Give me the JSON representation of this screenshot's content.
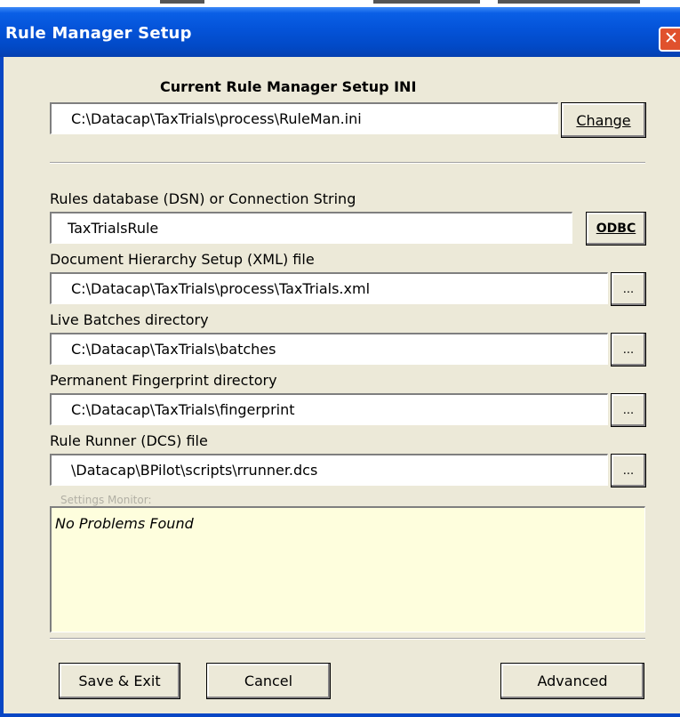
{
  "window": {
    "title": "Rule Manager Setup",
    "close_glyph": "✕"
  },
  "ini": {
    "heading": "Current Rule Manager Setup INI",
    "path": "C:\\Datacap\\TaxTrials\\process\\RuleMan.ini",
    "change_label": "Change"
  },
  "dsn": {
    "label": "Rules database (DSN) or Connection String",
    "value": "TaxTrialsRule",
    "odbc_label": "ODBC"
  },
  "hierarchy": {
    "label": "Document Hierarchy Setup (XML) file",
    "value": "C:\\Datacap\\TaxTrials\\process\\TaxTrials.xml"
  },
  "batches": {
    "label": "Live Batches directory",
    "value": "C:\\Datacap\\TaxTrials\\batches"
  },
  "fingerprint": {
    "label": "Permanent Fingerprint directory",
    "value": "C:\\Datacap\\TaxTrials\\fingerprint"
  },
  "runner": {
    "label": "Rule Runner (DCS) file",
    "value": "\\Datacap\\BPilot\\scripts\\rrunner.dcs"
  },
  "browse_label": "...",
  "monitor": {
    "label": "Settings Monitor:",
    "message": "No Problems Found"
  },
  "footer": {
    "save_label": "Save & Exit",
    "cancel_label": "Cancel",
    "advanced_label": "Advanced"
  },
  "colors": {
    "titlebar": "#0453d8",
    "dialog_bg": "#ece9d8",
    "monitor_bg": "#fefedd",
    "close_button": "#e0512d"
  },
  "icons": {
    "close": "close-icon"
  }
}
